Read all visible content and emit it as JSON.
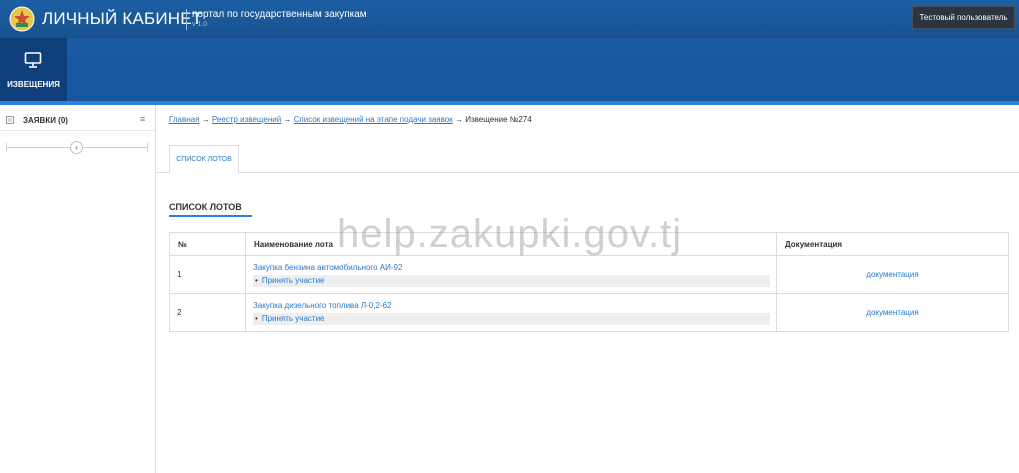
{
  "header": {
    "title": "ЛИЧНЫЙ КАБИНЕТ",
    "subtitle": "портал по государственным закупкам",
    "version": "v 1.0",
    "user_label": "Тестовый пользователь"
  },
  "nav": {
    "items": [
      {
        "label": "ИЗВЕЩЕНИЯ",
        "icon": "monitor-icon"
      }
    ]
  },
  "sidebar": {
    "items": [
      {
        "label": "ЗАЯВКИ (0)",
        "icon": "list-icon",
        "menu_icon": "≡"
      }
    ],
    "collapse_glyph": "‹"
  },
  "breadcrumb": {
    "items": [
      {
        "label": "Главная"
      },
      {
        "label": "Реестр извещений"
      },
      {
        "label": "Список извещений на этапе подачи заявок"
      },
      {
        "label": "Извещение №274"
      }
    ],
    "separator": "→"
  },
  "tabs": [
    {
      "label": "СПИСОК ЛОТОВ",
      "active": true
    }
  ],
  "lots": {
    "section_title": "СПИСОК ЛОТОВ",
    "columns": [
      "№",
      "Наименование лота",
      "Документация"
    ],
    "rows": [
      {
        "num": "1",
        "name": "Закупка бензина автомобильного АИ-92",
        "action": "Принять участие",
        "doc": "документация"
      },
      {
        "num": "2",
        "name": "Закупка дизельного топлива Л-0,2-62",
        "action": "Принять участие",
        "doc": "документация"
      }
    ]
  },
  "watermark": "help.zakupki.gov.tj",
  "colors": {
    "header_bg": "#1d5fa3",
    "nav_active": "#0f3f7a",
    "accent": "#2e7fd6",
    "link": "#2a7ac8",
    "user_menu_bg": "#2b3440"
  }
}
